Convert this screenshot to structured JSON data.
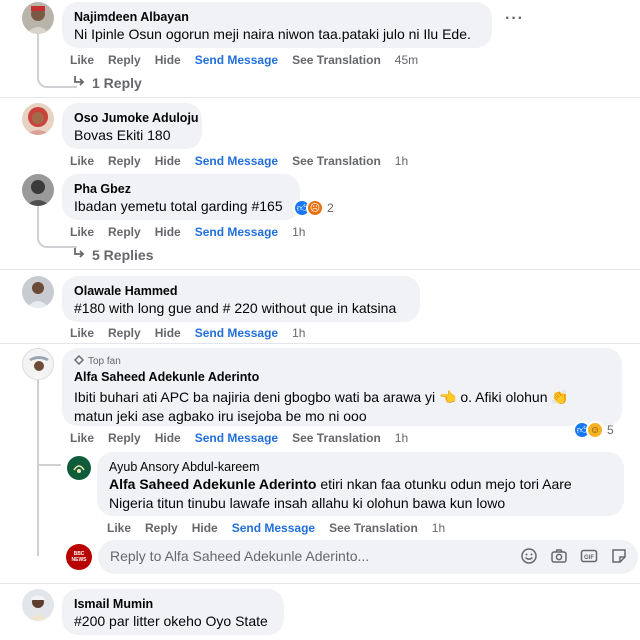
{
  "colors": {
    "accent": "#216fdb",
    "bubble": "#f0f2f5",
    "muted": "#65676b",
    "like": "#1877f2",
    "haha": "#f7b125"
  },
  "actions": {
    "like": "Like",
    "reply": "Reply",
    "hide": "Hide",
    "send": "Send Message",
    "translate": "See Translation"
  },
  "comments": [
    {
      "name": "Najimdeen Albayan",
      "text": "Ni Ipinle Osun ogorun meji naira niwon taa.pataki julo ni Ilu Ede.",
      "time": "45m",
      "replies": "1 Reply"
    },
    {
      "name": "Oso Jumoke Aduloju",
      "text": "Bovas Ekiti 180",
      "time": "1h"
    },
    {
      "name": "Pha Gbez",
      "text": "Ibadan yemetu total garding #165",
      "time": "1h",
      "reactions": "2",
      "replies": "5 Replies"
    },
    {
      "name": "Olawale Hammed",
      "text": "#180 with long gue and # 220 without que in katsina",
      "time": "1h"
    },
    {
      "badge": "Top fan",
      "name": "Alfa Saheed Adekunle Aderinto",
      "text1": "Ibiti buhari ati APC ba najiria deni gbogbo wati ba arawa yi",
      "text1b": "o. Afiki olohun",
      "text2": "matun jeki ase agbako iru isejoba be mo ni ooo",
      "time": "1h",
      "reactions": "5"
    },
    {
      "name": "Ismail Mumin",
      "text": "#200 par litter okeho Oyo State"
    }
  ],
  "reply": {
    "name": "Ayub Ansory Abdul-kareem",
    "mention": "Alfa Saheed Adekunle Aderinto",
    "text1": "etiri nkan faa otunku odun mejo tori Aare",
    "text2": "Nigeria titun tinubu lawafe insah allahu ki olohun bawa kun lowo",
    "time": "1h"
  },
  "reply_box": {
    "placeholder": "Reply to Alfa Saheed Adekunle Aderinto...",
    "avatar_text": "BBC NEWS"
  },
  "icons": [
    "more-icon",
    "reply-arrow-icon",
    "top-fan-icon",
    "like-reaction-icon",
    "angry-reaction-icon",
    "haha-reaction-icon",
    "emoji-icon",
    "camera-icon",
    "gif-icon",
    "sticker-icon"
  ]
}
